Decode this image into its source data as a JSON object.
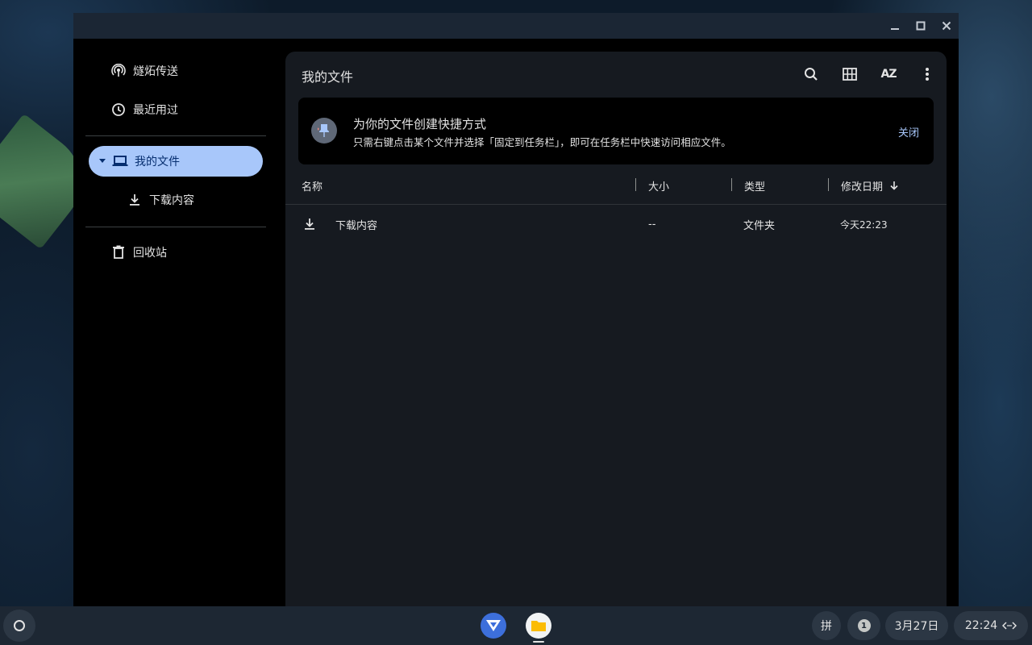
{
  "window": {
    "title": ""
  },
  "sidebar": {
    "items": [
      {
        "label": "燧炻传送",
        "icon": "nearby-share-icon"
      },
      {
        "label": "最近用过",
        "icon": "clock-icon"
      },
      {
        "label": "我的文件",
        "icon": "laptop-icon",
        "active": true
      },
      {
        "label": "下载内容",
        "icon": "download-icon"
      },
      {
        "label": "回收站",
        "icon": "trash-icon"
      }
    ]
  },
  "main": {
    "title": "我的文件",
    "toolbar": {
      "search": "search-icon",
      "grid": "grid-view-icon",
      "sort_label": "AZ",
      "more": "more-vert-icon"
    },
    "banner": {
      "title": "为你的文件创建快捷方式",
      "text": "只需右键点击某个文件并选择「固定到任务栏」，即可在任务栏中快速访问相应文件。",
      "dismiss": "关闭"
    },
    "columns": {
      "name": "名称",
      "size": "大小",
      "type": "类型",
      "modified": "修改日期"
    },
    "rows": [
      {
        "name": "下载内容",
        "size": "--",
        "type": "文件夹",
        "modified": "今天22:23",
        "icon": "download-icon"
      }
    ]
  },
  "shelf": {
    "ime": "拼",
    "notification_count": "1",
    "date": "3月27日",
    "time": "22:24"
  },
  "colors": {
    "accent": "#a8c7fa",
    "panel": "#161a20",
    "shelf": "#1d2733",
    "files_app": "#fbbc04"
  }
}
